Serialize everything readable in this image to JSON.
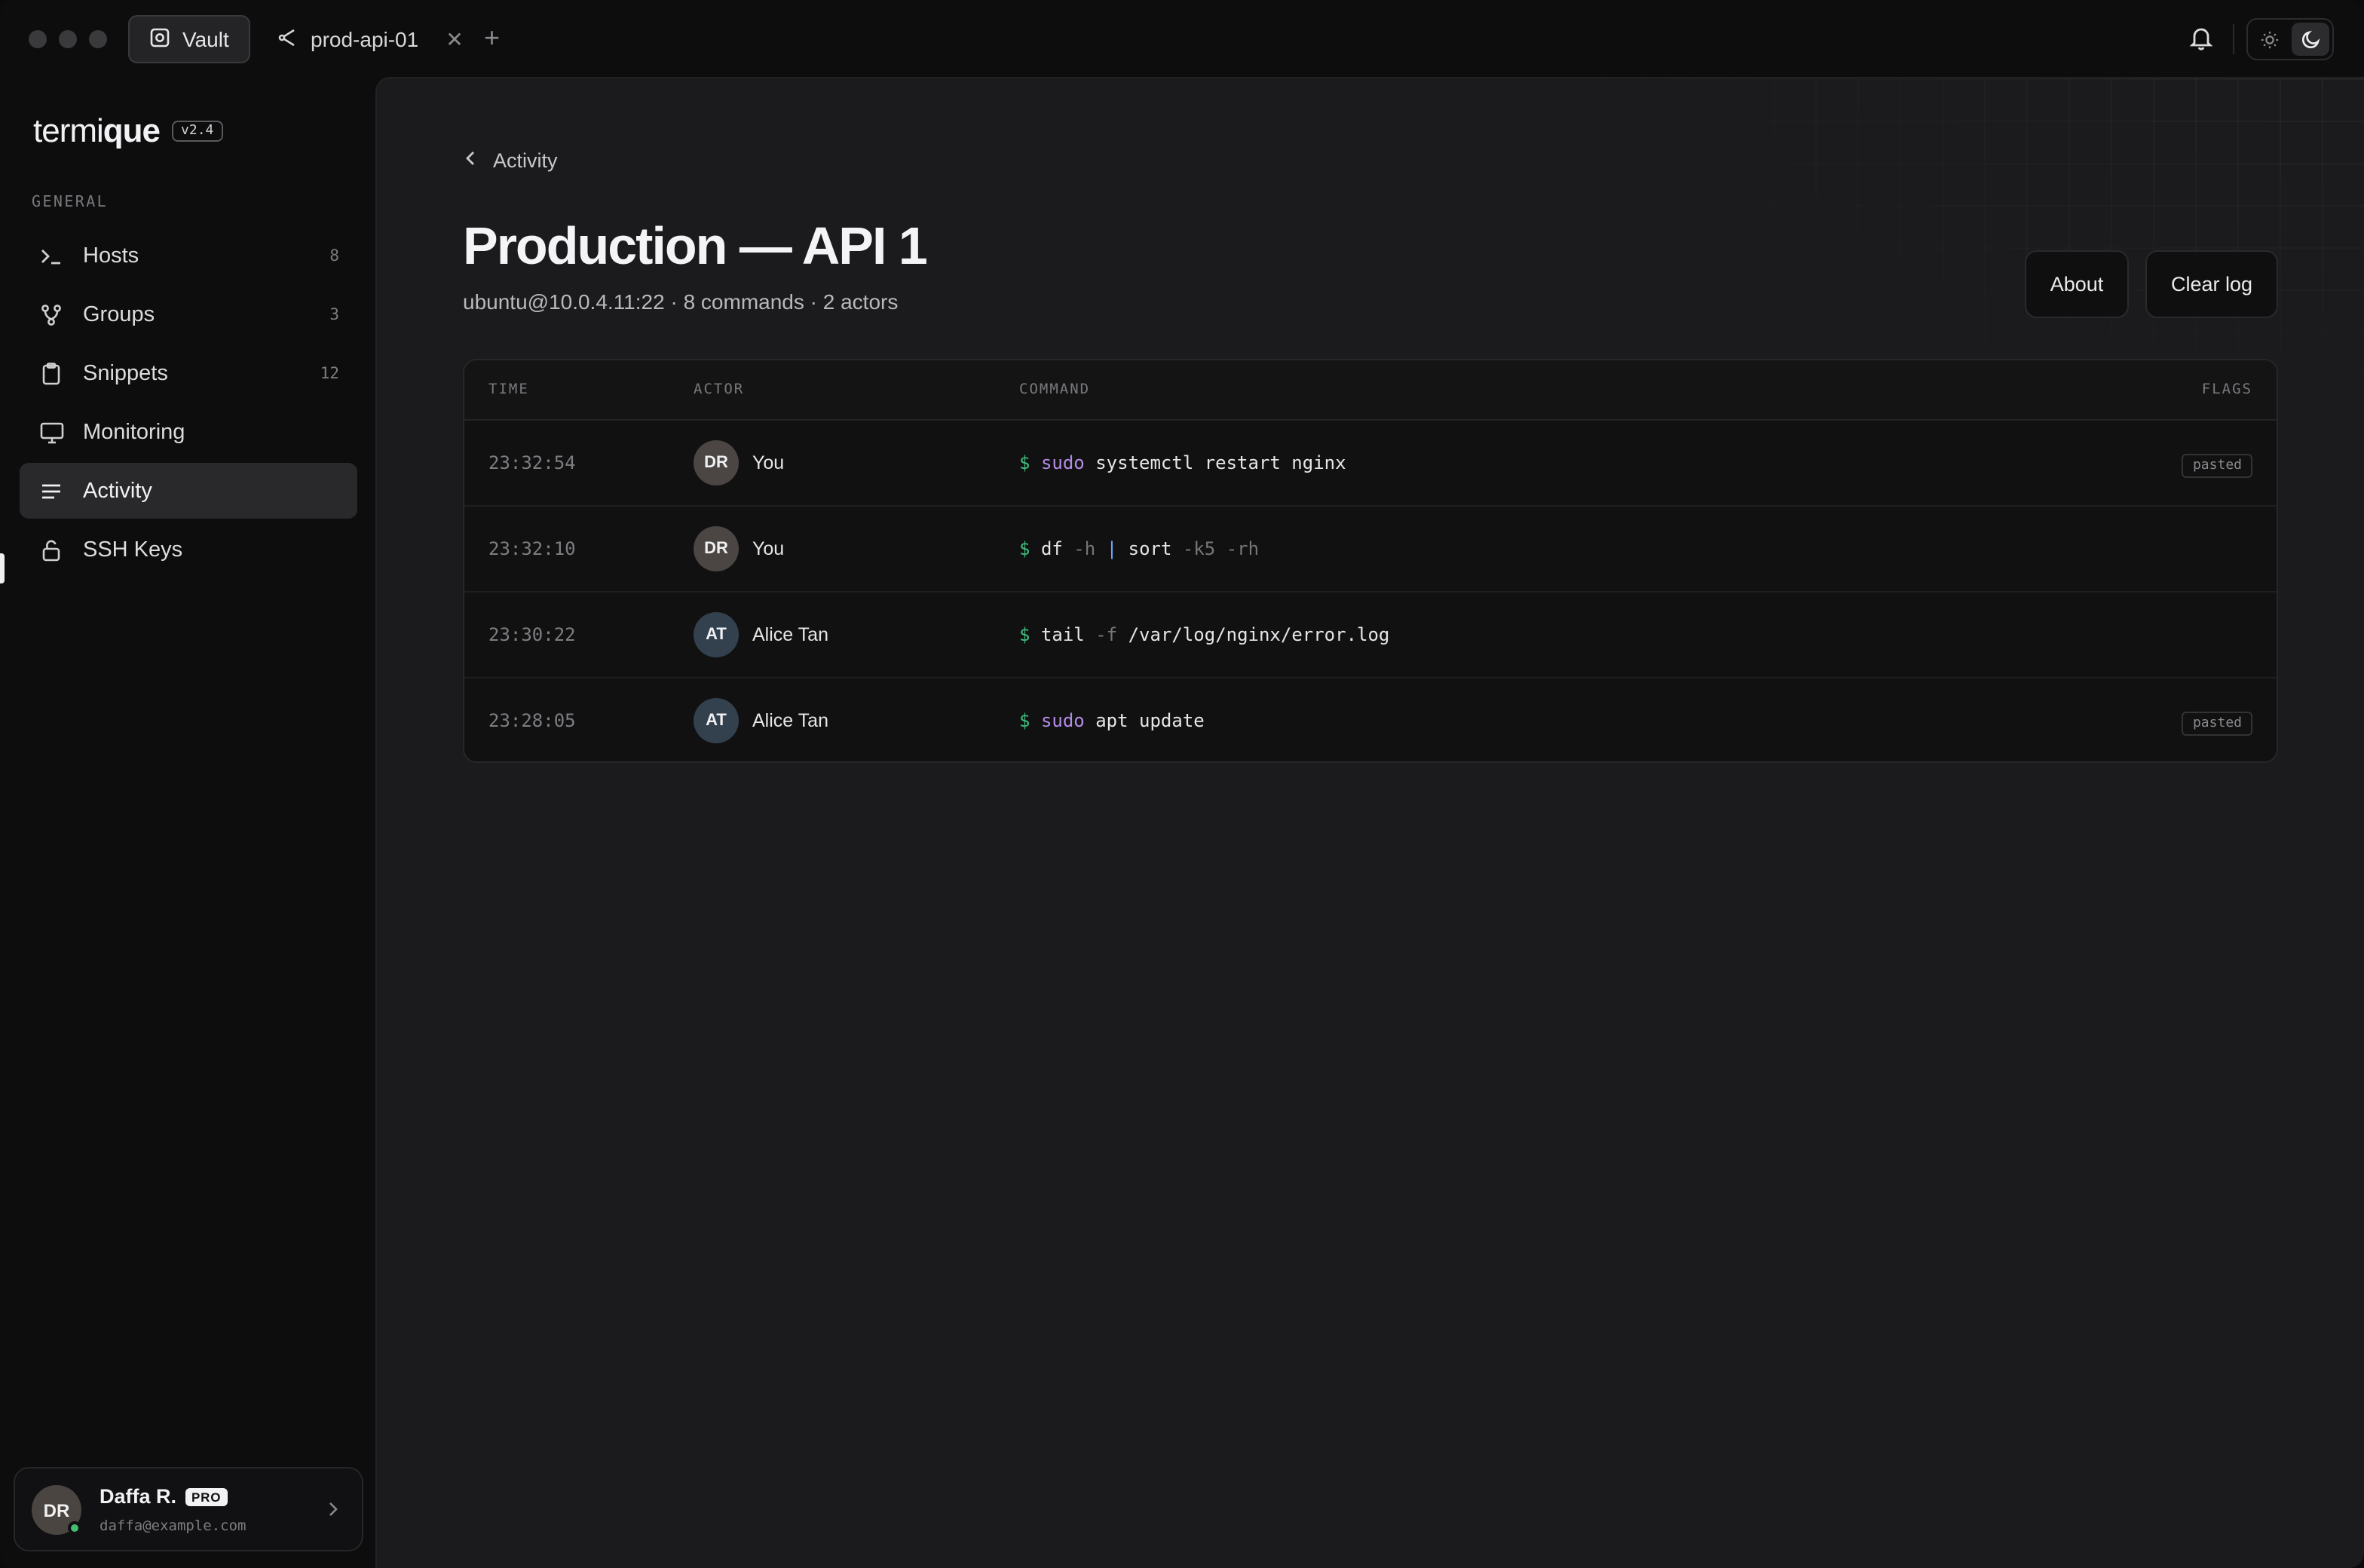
{
  "tabs": {
    "vault_label": "Vault",
    "session_label": "prod-api-01"
  },
  "sidebar": {
    "brand_light": "termi",
    "brand_bold": "que",
    "version": "v2.4",
    "section_label": "GENERAL",
    "items": [
      {
        "label": "Hosts",
        "count": "8"
      },
      {
        "label": "Groups",
        "count": "3"
      },
      {
        "label": "Snippets",
        "count": "12"
      },
      {
        "label": "Monitoring",
        "count": ""
      },
      {
        "label": "Activity",
        "count": ""
      },
      {
        "label": "SSH Keys",
        "count": ""
      }
    ],
    "active_item": "Activity",
    "user": {
      "initials": "DR",
      "name": "Daffa R.",
      "plan_badge": "PRO",
      "email": "daffa@example.com",
      "status_color": "#3fbf6f"
    }
  },
  "main": {
    "breadcrumb": "Activity",
    "title": "Production — API 1",
    "subtitle": "ubuntu@10.0.4.11:22 · 8 commands · 2 actors",
    "about_label": "About",
    "clear_label": "Clear log",
    "table": {
      "headers": {
        "time": "TIME",
        "actor": "ACTOR",
        "command": "COMMAND",
        "flags": "FLAGS"
      },
      "rows": [
        {
          "time": "23:32:54",
          "initials": "DR",
          "actor": "You",
          "flag": "pasted"
        },
        {
          "time": "23:32:10",
          "initials": "DR",
          "actor": "You",
          "flag": ""
        },
        {
          "time": "23:30:22",
          "initials": "AT",
          "actor": "Alice Tan",
          "flag": ""
        },
        {
          "time": "23:28:05",
          "initials": "AT",
          "actor": "Alice Tan",
          "flag": "pasted"
        }
      ],
      "commands": [
        {
          "prompt": "$",
          "sudo": "sudo",
          "rest": "systemctl restart nginx"
        },
        {
          "prompt": "$",
          "c1": "df",
          "f1": "-h",
          "pipe": "|",
          "c2": "sort",
          "f2": "-k5 -rh"
        },
        {
          "prompt": "$",
          "c1": "tail",
          "f1": "-f",
          "rest": "/var/log/nginx/error.log"
        },
        {
          "prompt": "$",
          "sudo": "sudo",
          "rest": "apt update"
        }
      ]
    }
  },
  "colors": {
    "prompt": "#3fbf7f",
    "sudo": "#b48ce6",
    "background": "#1b1b1d"
  }
}
